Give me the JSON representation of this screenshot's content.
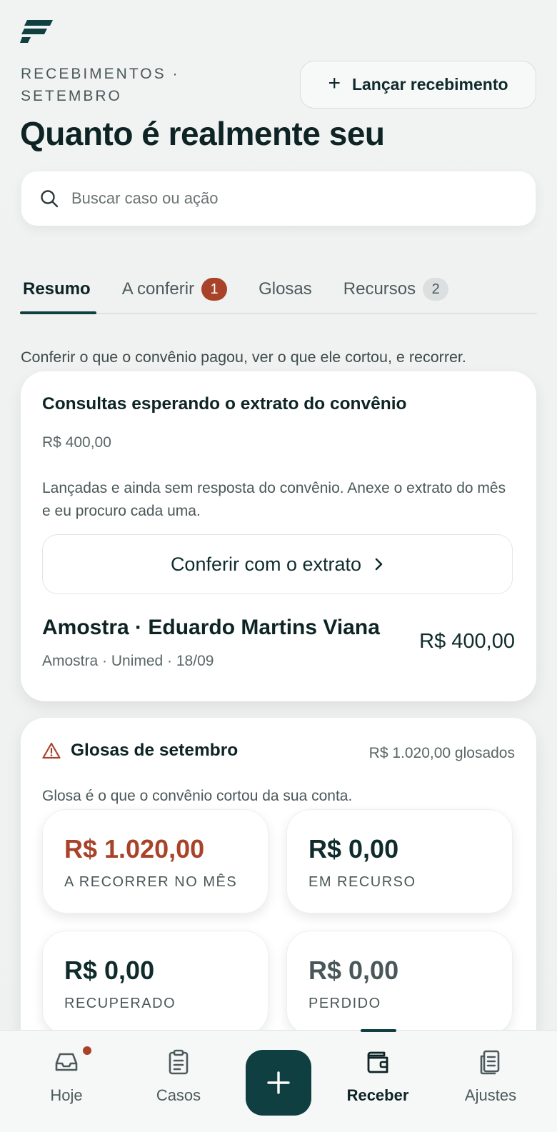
{
  "header": {
    "eyebrow": "RECEBIMENTOS · SETEMBRO",
    "title": "Quanto é realmente seu",
    "launch_label": "Lançar recebimento"
  },
  "search": {
    "placeholder": "Buscar caso ou ação"
  },
  "tabs": [
    {
      "label": "Resumo",
      "badge": ""
    },
    {
      "label": "A conferir",
      "badge": "1"
    },
    {
      "label": "Glosas",
      "badge": ""
    },
    {
      "label": "Recursos",
      "badge": "2"
    }
  ],
  "intro": "Conferir o que o convênio pagou, ver o que ele cortou, e recorrer.",
  "pending": {
    "title": "Consultas esperando o extrato do convênio",
    "amount": "R$ 400,00",
    "description": "Lançadas e ainda sem resposta do convênio. Anexe o extrato do mês e eu procuro cada uma.",
    "button_label": "Conferir com o extrato",
    "row": {
      "name": "Amostra · Eduardo Martins Viana",
      "meta": "Amostra · Unimed · 18/09",
      "value": "R$ 400,00"
    }
  },
  "glosas": {
    "title": "Glosas de setembro",
    "total": "R$ 1.020,00 glosados",
    "description": "Glosa é o que o convênio cortou da sua conta.",
    "stats": [
      {
        "value": "R$ 1.020,00",
        "label": "A RECORRER NO MÊS"
      },
      {
        "value": "R$ 0,00",
        "label": "EM RECURSO"
      },
      {
        "value": "R$ 0,00",
        "label": "RECUPERADO"
      },
      {
        "value": "R$ 0,00",
        "label": "PERDIDO"
      }
    ]
  },
  "nav": {
    "hoje": "Hoje",
    "casos": "Casos",
    "receber": "Receber",
    "ajustes": "Ajustes"
  },
  "colors": {
    "primary": "#0f3f40",
    "accent": "#a8432a",
    "background": "#f1f3f2"
  }
}
